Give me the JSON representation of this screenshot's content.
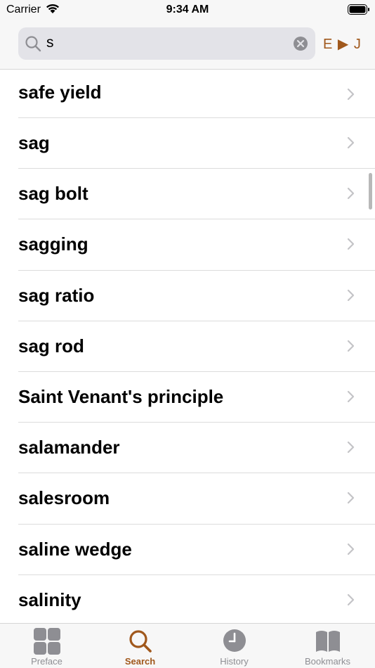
{
  "status_bar": {
    "carrier": "Carrier",
    "time": "9:34 AM"
  },
  "search": {
    "query": "s",
    "lang_toggle": "E ▶ J"
  },
  "results": [
    {
      "label": "safe yield"
    },
    {
      "label": "sag"
    },
    {
      "label": "sag bolt"
    },
    {
      "label": "sagging"
    },
    {
      "label": "sag ratio"
    },
    {
      "label": "sag rod"
    },
    {
      "label": "Saint Venant's principle"
    },
    {
      "label": "salamander"
    },
    {
      "label": "salesroom"
    },
    {
      "label": "saline wedge"
    },
    {
      "label": "salinity"
    }
  ],
  "tabs": [
    {
      "label": "Preface",
      "icon": "grid-icon",
      "active": false
    },
    {
      "label": "Search",
      "icon": "search-icon",
      "active": true
    },
    {
      "label": "History",
      "icon": "clock-icon",
      "active": false
    },
    {
      "label": "Bookmarks",
      "icon": "book-icon",
      "active": false
    }
  ],
  "colors": {
    "accent": "#a0581c",
    "inactive": "#8e8e93"
  }
}
